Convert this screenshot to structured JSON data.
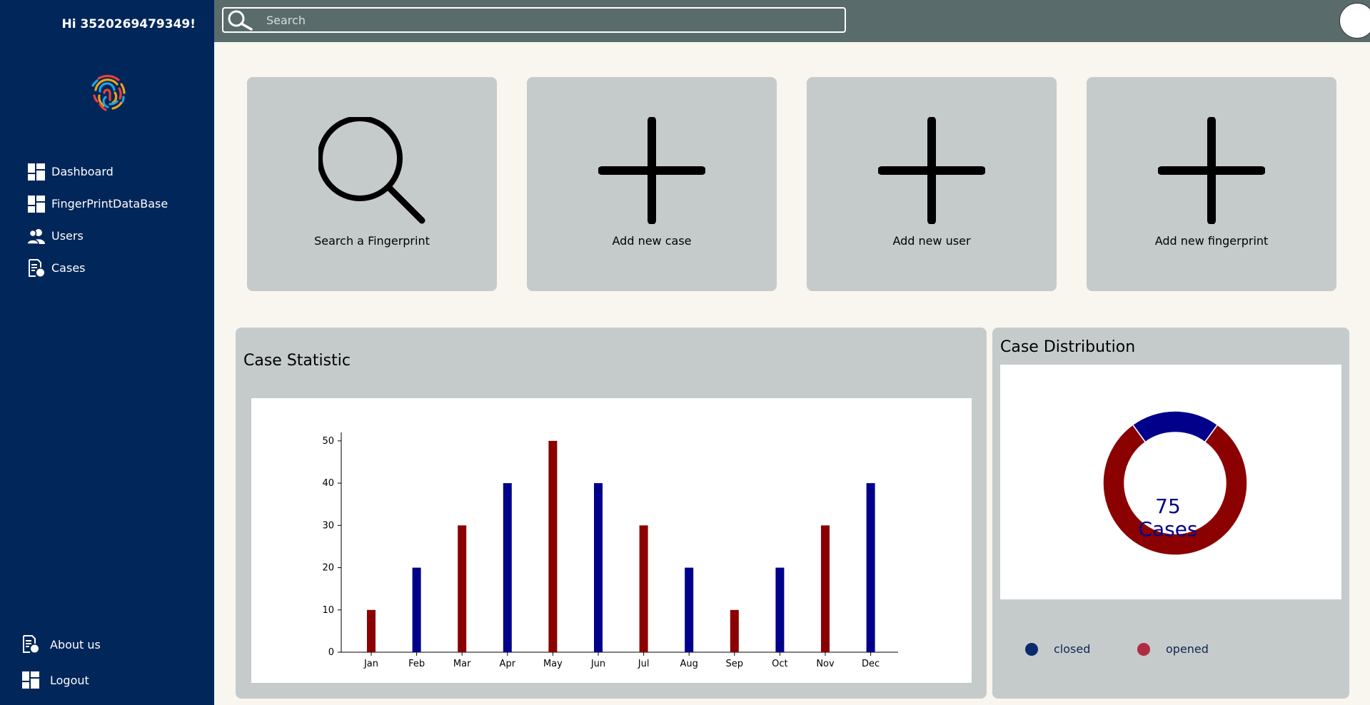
{
  "sidebar": {
    "greeting": "Hi 3520269479349!",
    "logo_icon": "fingerprint-logo",
    "items": [
      {
        "label": "Dashboard",
        "icon": "dashboard-icon"
      },
      {
        "label": "FingerPrintDataBase",
        "icon": "dashboard-icon"
      },
      {
        "label": "Users",
        "icon": "users-icon"
      },
      {
        "label": "Cases",
        "icon": "cases-icon"
      }
    ],
    "bottom_items": [
      {
        "label": "About us",
        "icon": "cases-icon"
      },
      {
        "label": "Logout",
        "icon": "dashboard-icon"
      }
    ]
  },
  "topbar": {
    "search_placeholder": "Search",
    "avatar": "user-avatar"
  },
  "cards": [
    {
      "label": "Search a Fingerprint",
      "icon": "search-icon"
    },
    {
      "label": "Add new case",
      "icon": "plus-icon"
    },
    {
      "label": "Add new user",
      "icon": "plus-icon"
    },
    {
      "label": "Add new fingerprint",
      "icon": "plus-icon"
    }
  ],
  "case_statistic": {
    "title": "Case Statistic"
  },
  "case_distribution": {
    "title": "Case Distribution",
    "center_number": "75",
    "center_label": "Cases",
    "legend": [
      {
        "label": "closed",
        "color": "#0a2a6b"
      },
      {
        "label": "opened",
        "color": "#b02c45"
      }
    ]
  },
  "colors": {
    "sidebar": "#01265a",
    "topbar": "#5a6b6b",
    "bar_red": "#8b0000",
    "bar_blue": "#00008b"
  },
  "chart_data": [
    {
      "type": "bar",
      "categories": [
        "Jan",
        "Feb",
        "Mar",
        "Apr",
        "May",
        "Jun",
        "Jul",
        "Aug",
        "Sep",
        "Oct",
        "Nov",
        "Dec"
      ],
      "values": [
        10,
        20,
        30,
        40,
        50,
        40,
        30,
        20,
        10,
        20,
        30,
        40
      ],
      "bar_colors": [
        "#8b0000",
        "#00008b",
        "#8b0000",
        "#00008b",
        "#8b0000",
        "#00008b",
        "#8b0000",
        "#00008b",
        "#8b0000",
        "#00008b",
        "#8b0000",
        "#00008b"
      ],
      "ylim": [
        0,
        52
      ],
      "yticks": [
        0,
        10,
        20,
        30,
        40,
        50
      ],
      "title": "",
      "xlabel": "",
      "ylabel": ""
    },
    {
      "type": "pie",
      "style": "donut",
      "slices": [
        {
          "label": "closed",
          "value": 15,
          "color": "#00008b"
        },
        {
          "label": "opened",
          "value": 60,
          "color": "#8b0000"
        }
      ]
    }
  ]
}
